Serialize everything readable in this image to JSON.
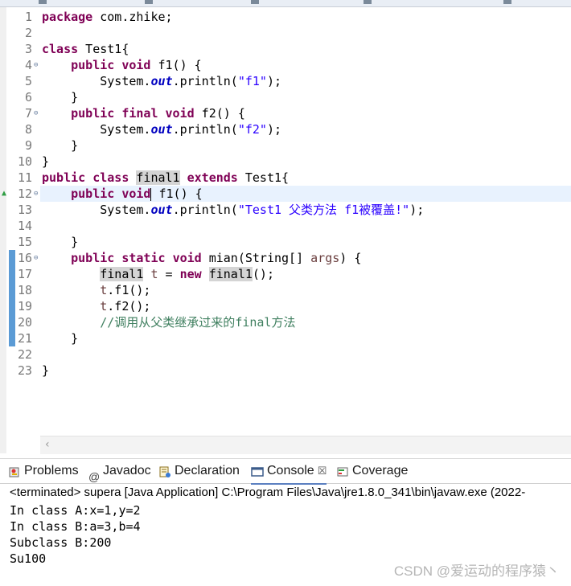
{
  "editor": {
    "line_numbers": [
      "1",
      "2",
      "3",
      "4",
      "5",
      "6",
      "7",
      "8",
      "9",
      "10",
      "11",
      "12",
      "13",
      "14",
      "15",
      "16",
      "17",
      "18",
      "19",
      "20",
      "21",
      "22",
      "23"
    ],
    "code": {
      "l1_kw": "package",
      "l1_rest": " com.zhike;",
      "l3_kw": "class",
      "l3_rest": " Test1{",
      "l4_kw1": "public",
      "l4_kw2": "void",
      "l4_rest": " f1() {",
      "l5_a": "System.",
      "l5_out": "out",
      "l5_b": ".println(",
      "l5_str": "\"f1\"",
      "l5_c": ");",
      "l6": "}",
      "l7_kw1": "public",
      "l7_kw2": "final",
      "l7_kw3": "void",
      "l7_rest": " f2() {",
      "l8_a": "System.",
      "l8_out": "out",
      "l8_b": ".println(",
      "l8_str": "\"f2\"",
      "l8_c": ");",
      "l9": "}",
      "l10": "}",
      "l11_kw1": "public",
      "l11_kw2": "class",
      "l11_name": "final1",
      "l11_kw3": "extends",
      "l11_rest": " Test1{",
      "l12_kw1": "public",
      "l12_kw2": "void",
      "l12_rest": " f1() {",
      "l13_a": "System.",
      "l13_out": "out",
      "l13_b": ".println(",
      "l13_str": "\"Test1 父类方法 f1被覆盖!\"",
      "l13_c": ");",
      "l15": "}",
      "l16_kw1": "public",
      "l16_kw2": "static",
      "l16_kw3": "void",
      "l16_a": " mian(String[] ",
      "l16_var": "args",
      "l16_b": ") {",
      "l17_type": "final1",
      "l17_var": "t",
      "l17_mid": " = ",
      "l17_kw": "new",
      "l17_ctor": "final1",
      "l17_end": "();",
      "l18_var": "t",
      "l18_rest": ".f1();",
      "l19_var": "t",
      "l19_rest": ".f2();",
      "l20_cmt": "//调用从父类继承过来的final方法",
      "l21": "}",
      "l23": "}"
    }
  },
  "panel": {
    "tabs": [
      {
        "label": "Problems"
      },
      {
        "label": "Javadoc"
      },
      {
        "label": "Declaration"
      },
      {
        "label": "Console",
        "close": "☒"
      },
      {
        "label": "Coverage"
      }
    ],
    "console_header": "<terminated> supera [Java Application] C:\\Program Files\\Java\\jre1.8.0_341\\bin\\javaw.exe  (2022-",
    "output": [
      "In class A:x=1,y=2",
      "In class B:a=3,b=4",
      "Subclass B:200",
      "Su100"
    ]
  },
  "watermark": "CSDN @爱运动的程序猿丶",
  "icons": {
    "fold": "⊖",
    "override": "▲",
    "scroll_left": "‹",
    "javadoc": "@"
  },
  "colors": {
    "keyword": "#7f0055",
    "string": "#2a00ff",
    "field": "#0000c0",
    "comment": "#3f7f5f",
    "current_line": "#e8f2fe"
  }
}
